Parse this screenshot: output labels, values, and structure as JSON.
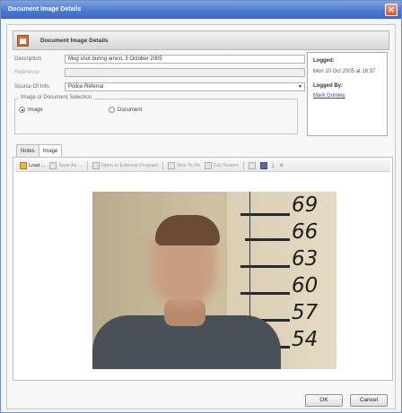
{
  "window": {
    "title": "Document Image Details",
    "close_glyph": "✕"
  },
  "header": {
    "title": "Document Image Details"
  },
  "form": {
    "description_label": "Description",
    "description_value": "Mug shot during arrest, 3 October 2005",
    "reference_label": "Reference",
    "reference_value": "",
    "source_label": "Source Of Info",
    "source_value": "Police Referral",
    "selection_legend": "Image or Document Selection",
    "option_image": "Image",
    "option_document": "Document",
    "selected_option": "Image"
  },
  "logged": {
    "logged_heading": "Logged:",
    "logged_value": "Mon 10 Oct 2005 at 16:37",
    "logged_by_heading": "Logged By:",
    "logged_by_value": "Mark Grimley"
  },
  "tabs": [
    {
      "label": "Notes",
      "active": false
    },
    {
      "label": "Image",
      "active": true
    }
  ],
  "toolbar": {
    "load": "Load ...",
    "save_as": "Save As ...",
    "open_external": "Open in External Program",
    "size_to_fit": "Size To Fit",
    "full_screen": "Full Screen"
  },
  "mugshot": {
    "height_marks": [
      "69",
      "66",
      "63",
      "60",
      "57",
      "54"
    ]
  },
  "buttons": {
    "ok": "OK",
    "cancel": "Cancel"
  },
  "colors": {
    "titlebar": "#4a76cf",
    "link": "#2a48b8"
  }
}
